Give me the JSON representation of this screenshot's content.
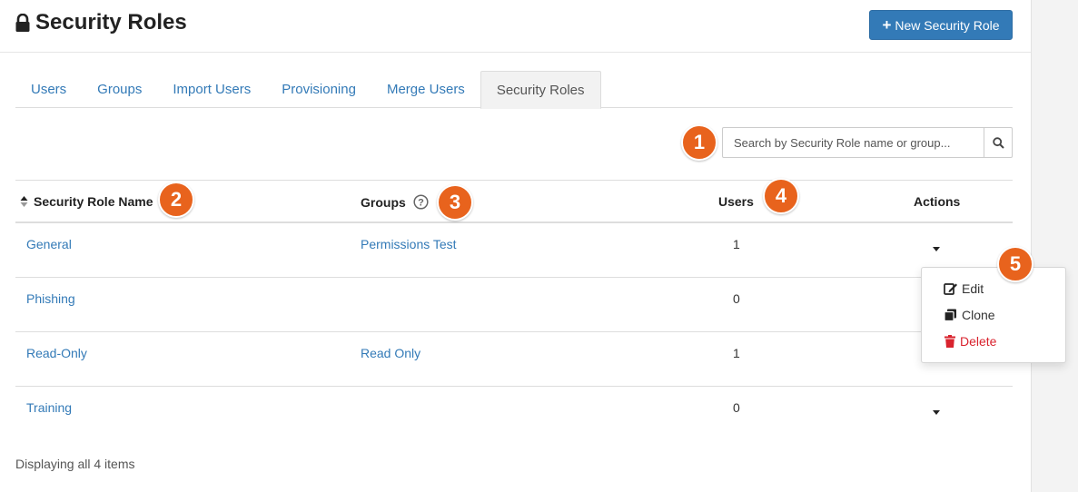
{
  "header": {
    "title": "Security Roles",
    "new_button_label": "New Security Role"
  },
  "tabs": [
    {
      "label": "Users"
    },
    {
      "label": "Groups"
    },
    {
      "label": "Import Users"
    },
    {
      "label": "Provisioning"
    },
    {
      "label": "Merge Users"
    },
    {
      "label": "Security Roles",
      "active": true
    }
  ],
  "search": {
    "placeholder": "Search by Security Role name or group..."
  },
  "table": {
    "columns": {
      "name": "Security Role Name",
      "groups": "Groups",
      "users": "Users",
      "actions": "Actions"
    },
    "rows": [
      {
        "name": "General",
        "group": "Permissions Test",
        "users": "1"
      },
      {
        "name": "Phishing",
        "group": "",
        "users": "0"
      },
      {
        "name": "Read-Only",
        "group": "Read Only",
        "users": "1"
      },
      {
        "name": "Training",
        "group": "",
        "users": "0"
      }
    ]
  },
  "actions_menu": {
    "edit": "Edit",
    "clone": "Clone",
    "delete": "Delete"
  },
  "callouts": [
    "1",
    "2",
    "3",
    "4",
    "5"
  ],
  "footer": {
    "status": "Displaying all 4 items"
  },
  "colors": {
    "accent": "#337ab7",
    "callout": "#e8631d",
    "danger": "#d9232e"
  }
}
